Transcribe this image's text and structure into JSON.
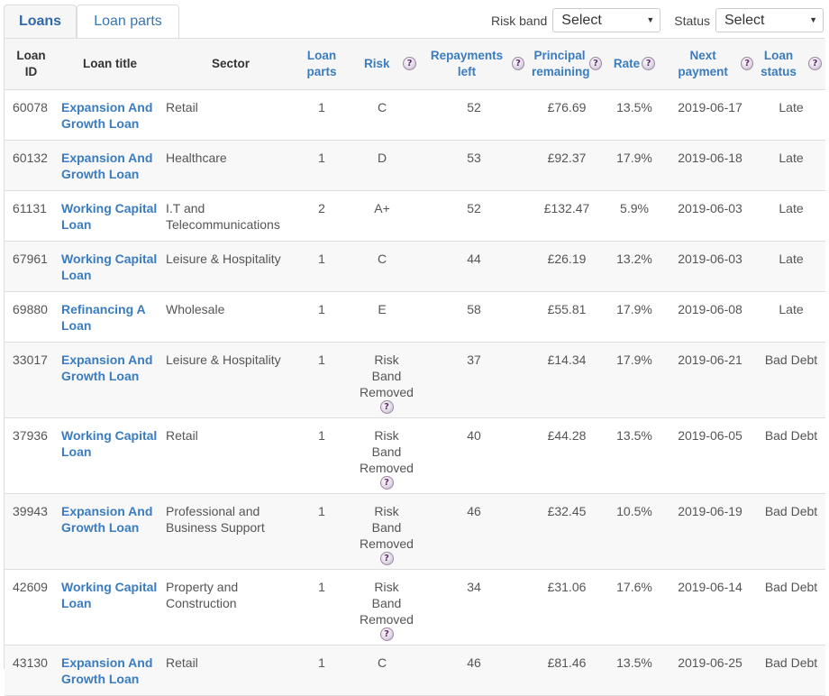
{
  "tabs": [
    {
      "label": "Loans",
      "active": true
    },
    {
      "label": "Loan parts",
      "active": false
    }
  ],
  "filters": {
    "risk_band": {
      "label": "Risk band",
      "value": "Select"
    },
    "status": {
      "label": "Status",
      "value": "Select"
    }
  },
  "icons": {
    "help": "?",
    "caret": "▼"
  },
  "colors": {
    "link": "#3a7cbf",
    "header_bg": "#f6f6f6",
    "row_alt_bg": "#f8f8f8",
    "border": "#dddddd"
  },
  "columns": [
    {
      "label": "Loan ID",
      "sortable": false,
      "help": false
    },
    {
      "label": "Loan title",
      "sortable": false,
      "help": false
    },
    {
      "label": "Sector",
      "sortable": false,
      "help": false
    },
    {
      "label": "Loan parts",
      "sortable": true,
      "help": false
    },
    {
      "label": "Risk",
      "sortable": true,
      "help": true
    },
    {
      "label": "Repayments left",
      "sortable": true,
      "help": true
    },
    {
      "label": "Principal remaining",
      "sortable": true,
      "help": true
    },
    {
      "label": "Rate",
      "sortable": true,
      "help": true
    },
    {
      "label": "Next payment",
      "sortable": true,
      "help": true
    },
    {
      "label": "Loan status",
      "sortable": true,
      "help": true
    }
  ],
  "rows": [
    {
      "id": "60078",
      "title": "Expansion And Growth Loan",
      "sector": "Retail",
      "parts": "1",
      "risk": "C",
      "risk_removed": false,
      "repayments": "52",
      "principal": "£76.69",
      "rate": "13.5%",
      "next": "2019-06-17",
      "status": "Late"
    },
    {
      "id": "60132",
      "title": "Expansion And Growth Loan",
      "sector": "Healthcare",
      "parts": "1",
      "risk": "D",
      "risk_removed": false,
      "repayments": "53",
      "principal": "£92.37",
      "rate": "17.9%",
      "next": "2019-06-18",
      "status": "Late"
    },
    {
      "id": "61131",
      "title": "Working Capital Loan",
      "sector": "I.T and Telecommunications",
      "parts": "2",
      "risk": "A+",
      "risk_removed": false,
      "repayments": "52",
      "principal": "£132.47",
      "rate": "5.9%",
      "next": "2019-06-03",
      "status": "Late"
    },
    {
      "id": "67961",
      "title": "Working Capital Loan",
      "sector": "Leisure & Hospitality",
      "parts": "1",
      "risk": "C",
      "risk_removed": false,
      "repayments": "44",
      "principal": "£26.19",
      "rate": "13.2%",
      "next": "2019-06-03",
      "status": "Late"
    },
    {
      "id": "69880",
      "title": "Refinancing A Loan",
      "sector": "Wholesale",
      "parts": "1",
      "risk": "E",
      "risk_removed": false,
      "repayments": "58",
      "principal": "£55.81",
      "rate": "17.9%",
      "next": "2019-06-08",
      "status": "Late"
    },
    {
      "id": "33017",
      "title": "Expansion And Growth Loan",
      "sector": "Leisure & Hospitality",
      "parts": "1",
      "risk": "Risk Band Removed",
      "risk_removed": true,
      "repayments": "37",
      "principal": "£14.34",
      "rate": "17.9%",
      "next": "2019-06-21",
      "status": "Bad Debt"
    },
    {
      "id": "37936",
      "title": "Working Capital Loan",
      "sector": "Retail",
      "parts": "1",
      "risk": "Risk Band Removed",
      "risk_removed": true,
      "repayments": "40",
      "principal": "£44.28",
      "rate": "13.5%",
      "next": "2019-06-05",
      "status": "Bad Debt"
    },
    {
      "id": "39943",
      "title": "Expansion And Growth Loan",
      "sector": "Professional and Business Support",
      "parts": "1",
      "risk": "Risk Band Removed",
      "risk_removed": true,
      "repayments": "46",
      "principal": "£32.45",
      "rate": "10.5%",
      "next": "2019-06-19",
      "status": "Bad Debt"
    },
    {
      "id": "42609",
      "title": "Working Capital Loan",
      "sector": "Property and Construction",
      "parts": "1",
      "risk": "Risk Band Removed",
      "risk_removed": true,
      "repayments": "34",
      "principal": "£31.06",
      "rate": "17.6%",
      "next": "2019-06-14",
      "status": "Bad Debt"
    },
    {
      "id": "43130",
      "title": "Expansion And Growth Loan",
      "sector": "Retail",
      "parts": "1",
      "risk": "C",
      "risk_removed": false,
      "repayments": "46",
      "principal": "£81.46",
      "rate": "13.5%",
      "next": "2019-06-25",
      "status": "Bad Debt"
    }
  ]
}
